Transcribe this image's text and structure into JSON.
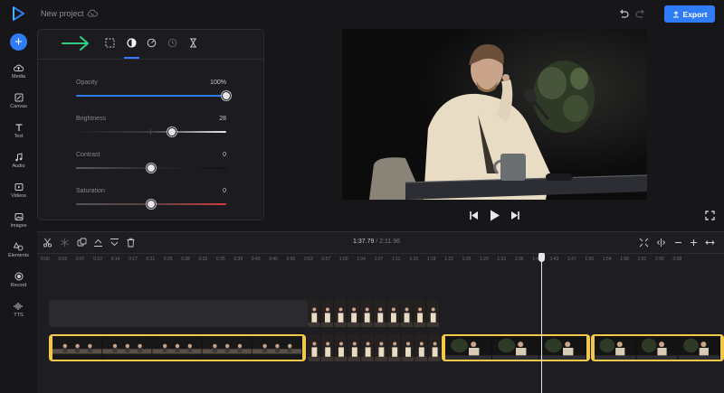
{
  "app": {
    "project_title": "New project",
    "export_label": "Export",
    "accent_color": "#2f7cf6",
    "selection_color": "#f2c84b"
  },
  "sidebar": {
    "add_icon": "plus-icon",
    "items": [
      {
        "label": "Media",
        "icon": "cloud-upload-icon"
      },
      {
        "label": "Canvas",
        "icon": "canvas-icon"
      },
      {
        "label": "Text",
        "icon": "text-icon"
      },
      {
        "label": "Audio",
        "icon": "music-note-icon"
      },
      {
        "label": "Videos",
        "icon": "video-play-icon"
      },
      {
        "label": "Images",
        "icon": "image-icon"
      },
      {
        "label": "Elements",
        "icon": "shapes-icon"
      },
      {
        "label": "Record",
        "icon": "record-icon"
      },
      {
        "label": "TTS",
        "icon": "waveform-icon"
      }
    ]
  },
  "panel": {
    "tools": [
      "crop-icon",
      "adjust-contrast-icon",
      "speed-icon",
      "clock-icon",
      "hourglass-icon"
    ],
    "active_tool": "adjust-contrast-icon",
    "sliders": [
      {
        "label": "Opacity",
        "value": "100%",
        "fraction": 1.0,
        "fill": "#2f7cf6"
      },
      {
        "label": "Brightness",
        "value": "28",
        "fraction": 0.64,
        "fill": "gradient-dark-light"
      },
      {
        "label": "Contrast",
        "value": "0",
        "fraction": 0.5,
        "fill": "gradient-dark"
      },
      {
        "label": "Saturation",
        "value": "0",
        "fraction": 0.5,
        "fill": "gradient-gray-red"
      }
    ]
  },
  "player": {
    "controls": [
      "skip-back-icon",
      "play-icon",
      "skip-forward-icon"
    ],
    "fullscreen_icon": "fullscreen-icon"
  },
  "timeline": {
    "tools": [
      "scissors-icon",
      "freeze-icon",
      "duplicate-icon",
      "move-up-icon",
      "move-down-icon",
      "trash-icon"
    ],
    "current_time": "1:37.79",
    "separator": " / ",
    "total_time": "2:11.96",
    "zoom_tools": [
      "fit-icon",
      "split-view-icon",
      "zoom-out-icon",
      "zoom-in-icon",
      "expand-icon"
    ],
    "ruler_labels": [
      "0:00",
      "0:03",
      "0:07",
      "0:10",
      "0:14",
      "0:17",
      "0:21",
      "0:25",
      "0:28",
      "0:32",
      "0:35",
      "0:39",
      "0:43",
      "0:46",
      "0:50",
      "0:53",
      "0:57",
      "1:00",
      "1:04",
      "1:07",
      "1:11",
      "1:15",
      "1:18",
      "1:22",
      "1:25",
      "1:29",
      "1:32",
      "1:36",
      "1:40",
      "1:43",
      "1:47",
      "1:50",
      "1:54",
      "1:58",
      "2:01",
      "2:05",
      "2:08"
    ],
    "playhead_fraction": 0.74
  }
}
